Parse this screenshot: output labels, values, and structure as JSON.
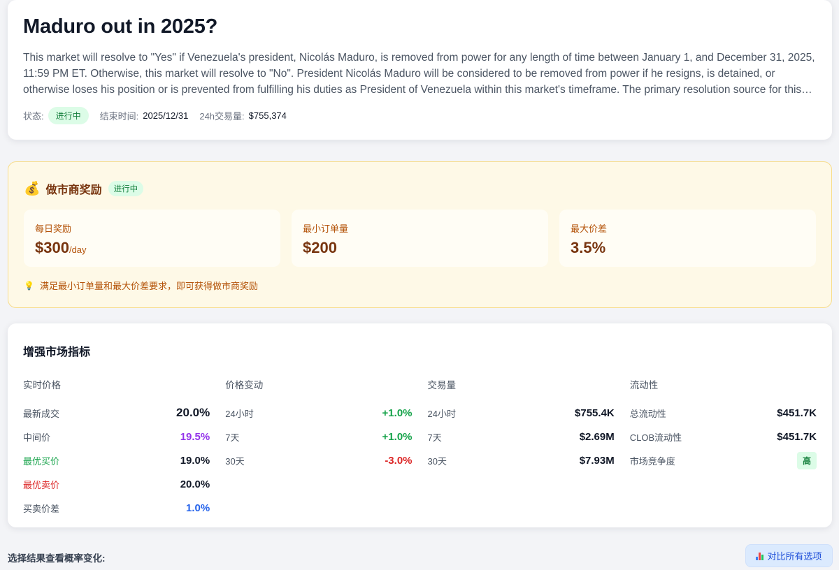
{
  "market": {
    "title": "Maduro out in 2025?",
    "description": "This market will resolve to \"Yes\" if Venezuela's president, Nicolás Maduro, is removed from power for any length of time between January 1, and December 31, 2025, 11:59 PM ET. Otherwise, this market will resolve to \"No\". President Nicolás Maduro will be considered to be removed from power if he resigns, is detained, or otherwise loses his position or is prevented from fulfilling his duties as President of Venezuela within this market's timeframe. The primary resolution source for this market will be a consensus of credible reporting.",
    "status_label": "状态:",
    "status_value": "进行中",
    "end_label": "结束时间:",
    "end_value": "2025/12/31",
    "volume_label": "24h交易量:",
    "volume_value": "$755,374"
  },
  "rewards": {
    "icon": "money-bag-icon",
    "title": "做市商奖励",
    "status": "进行中",
    "daily_label": "每日奖励",
    "daily_value": "$300",
    "daily_unit": "/day",
    "min_order_label": "最小订单量",
    "min_order_value": "$200",
    "max_spread_label": "最大价差",
    "max_spread_value": "3.5%",
    "note": "满足最小订单量和最大价差要求，即可获得做市商奖励"
  },
  "metrics": {
    "title": "增强市场指标",
    "price": {
      "title": "实时价格",
      "rows": [
        {
          "label": "最新成交",
          "value": "20.0%"
        },
        {
          "label": "中间价",
          "value": "19.5%"
        },
        {
          "label": "最优买价",
          "value": "19.0%"
        },
        {
          "label": "最优卖价",
          "value": "20.0%"
        },
        {
          "label": "买卖价差",
          "value": "1.0%"
        }
      ]
    },
    "change": {
      "title": "价格变动",
      "rows": [
        {
          "label": "24小时",
          "value": "+1.0%"
        },
        {
          "label": "7天",
          "value": "+1.0%"
        },
        {
          "label": "30天",
          "value": "-3.0%"
        }
      ]
    },
    "volume": {
      "title": "交易量",
      "rows": [
        {
          "label": "24小时",
          "value": "$755.4K"
        },
        {
          "label": "7天",
          "value": "$2.69M"
        },
        {
          "label": "30天",
          "value": "$7.93M"
        }
      ]
    },
    "liquidity": {
      "title": "流动性",
      "rows": [
        {
          "label": "总流动性",
          "value": "$451.7K"
        },
        {
          "label": "CLOB流动性",
          "value": "$451.7K"
        },
        {
          "label": "市场竞争度",
          "value": "高"
        }
      ]
    }
  },
  "footer": {
    "select_label": "选择结果查看概率变化:",
    "compare_icon": "bar-chart-icon",
    "compare_label": "对比所有选项"
  },
  "colors": {
    "positive": "#16a34a",
    "negative": "#dc2626",
    "mid_price": "#9333ea",
    "spread": "#2563eb",
    "reward_bg": "#fef9e7",
    "reward_text": "#78350f"
  }
}
